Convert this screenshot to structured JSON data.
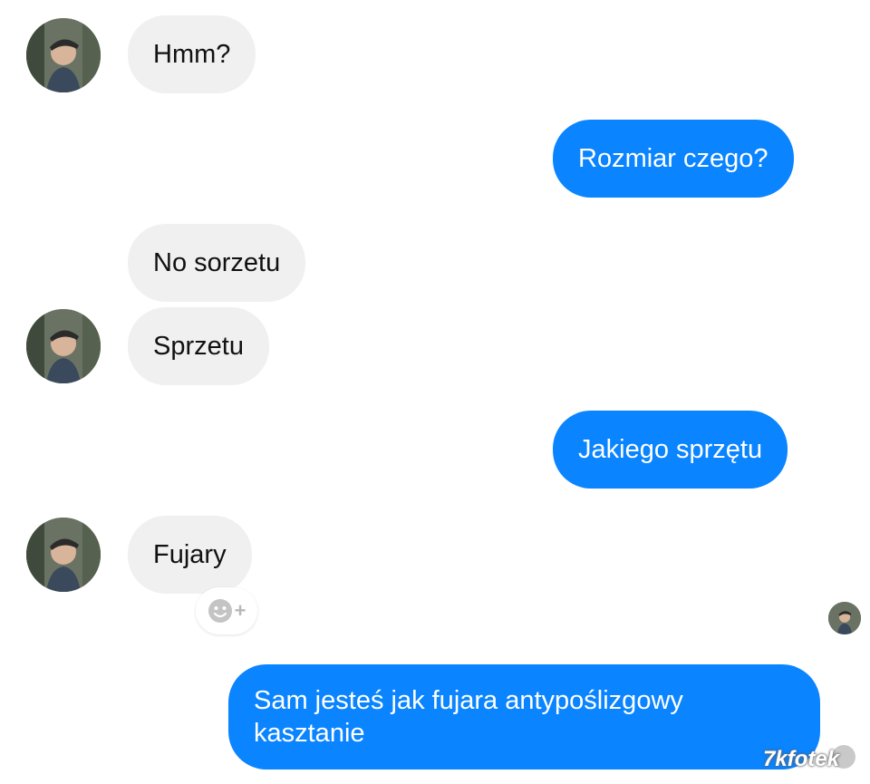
{
  "conversation": {
    "accent_color": "#0a84ff",
    "incoming_bubble_color": "#f1f0f0",
    "messages": [
      {
        "sender": "contact",
        "text": "Hmm?"
      },
      {
        "sender": "me",
        "text": "Rozmiar czego?"
      },
      {
        "sender": "contact",
        "text": "No sorzetu"
      },
      {
        "sender": "contact",
        "text": "Sprzetu"
      },
      {
        "sender": "me",
        "text": "Jakiego sprzętu"
      },
      {
        "sender": "contact",
        "text": "Fujary"
      },
      {
        "sender": "me",
        "text_line1": "Sam jesteś jak fujara antypoślizgowy",
        "text_line2": "kasztanie"
      }
    ]
  },
  "reaction_button": {
    "icon": "smiley-add-icon",
    "plus": "+"
  },
  "watermark": {
    "text": "7kfotek"
  }
}
